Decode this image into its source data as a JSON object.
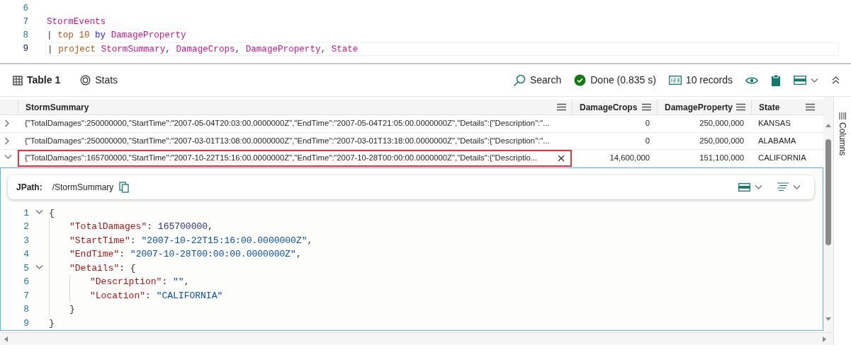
{
  "editor": {
    "lines": [
      {
        "number": "6",
        "current": false
      },
      {
        "number": "7",
        "current": false,
        "tokens": [
          {
            "text": "StormEvents",
            "kind": "identifier"
          }
        ]
      },
      {
        "number": "8",
        "current": false,
        "tokens": [
          {
            "text": "|",
            "kind": "pipe"
          },
          {
            "text": "top",
            "kind": "command"
          },
          {
            "text": "10",
            "kind": "literal"
          },
          {
            "text": "by",
            "kind": "operator"
          },
          {
            "text": "DamageProperty",
            "kind": "identifier"
          }
        ]
      },
      {
        "number": "9",
        "current": true,
        "tokens": [
          {
            "text": "|",
            "kind": "pipe"
          },
          {
            "text": "project",
            "kind": "command"
          },
          {
            "text": "StormSummary",
            "kind": "identifier"
          },
          {
            "text": ",",
            "kind": "punct"
          },
          {
            "text": "DamageCrops",
            "kind": "identifier"
          },
          {
            "text": ",",
            "kind": "punct"
          },
          {
            "text": "DamageProperty",
            "kind": "identifier"
          },
          {
            "text": ",",
            "kind": "punct"
          },
          {
            "text": "State",
            "kind": "identifier"
          }
        ]
      }
    ]
  },
  "results": {
    "tabs": [
      {
        "label": "Table 1",
        "selected": true,
        "kind": "table"
      },
      {
        "label": "Stats",
        "selected": false,
        "kind": "stats"
      }
    ],
    "search": "Search",
    "status": "Done (0.835 s)",
    "records": "10 records"
  },
  "table": {
    "columns": [
      "StormSummary",
      "DamageCrops",
      "DamageProperty",
      "State"
    ],
    "rows": [
      {
        "expanded": false,
        "selected": false,
        "cells": [
          "{\"TotalDamages\":250000000,\"StartTime\":\"2007-05-04T20:03:00.0000000Z\",\"EndTime\":\"2007-05-04T21:05:00.0000000Z\",\"Details\":{\"Description\":\"...",
          "0",
          "250,000,000",
          "KANSAS"
        ]
      },
      {
        "expanded": false,
        "selected": false,
        "cells": [
          "{\"TotalDamages\":250000000,\"StartTime\":\"2007-03-01T13:08:00.0000000Z\",\"EndTime\":\"2007-03-01T13:18:00.0000000Z\",\"Details\":{\"Description\":\"...",
          "0",
          "250,000,000",
          "ALABAMA"
        ]
      },
      {
        "expanded": true,
        "selected": true,
        "cells": [
          "{\"TotalDamages\":165700000,\"StartTime\":\"2007-10-22T15:16:00.0000000Z\",\"EndTime\":\"2007-10-28T00:00:00.0000000Z\",\"Details\":{\"Descriptio...",
          "14,600,000",
          "151,100,000",
          "CALIFORNIA"
        ]
      }
    ]
  },
  "detail": {
    "jpath_label": "JPath:",
    "jpath": "/StormSummary",
    "lines": [
      {
        "number": "1",
        "expanded": true,
        "tokens": [
          {
            "text": "{",
            "kind": "punct"
          }
        ],
        "children": [
          {
            "number": "2",
            "tokens": [
              {
                "text": "\"TotalDamages\"",
                "kind": "key"
              },
              {
                "text": ":",
                "kind": "punct"
              },
              {
                "text": "165700000",
                "kind": "number"
              },
              {
                "text": ",",
                "kind": "punct"
              }
            ]
          },
          {
            "number": "3",
            "tokens": [
              {
                "text": "\"StartTime\"",
                "kind": "key"
              },
              {
                "text": ":",
                "kind": "punct"
              },
              {
                "text": "\"2007-10-22T15:16:00.0000000Z\"",
                "kind": "string"
              },
              {
                "text": ",",
                "kind": "punct"
              }
            ]
          },
          {
            "number": "4",
            "tokens": [
              {
                "text": "\"EndTime\"",
                "kind": "key"
              },
              {
                "text": ":",
                "kind": "punct"
              },
              {
                "text": "\"2007-10-28T00:00:00.0000000Z\"",
                "kind": "string"
              },
              {
                "text": ",",
                "kind": "punct"
              }
            ]
          },
          {
            "number": "5",
            "expanded": true,
            "tokens": [
              {
                "text": "\"Details\"",
                "kind": "key"
              },
              {
                "text": ":",
                "kind": "punct"
              },
              {
                "text": "{",
                "kind": "brace"
              }
            ],
            "children": [
              {
                "number": "6",
                "tokens": [
                  {
                    "text": "\"Description\"",
                    "kind": "key"
                  },
                  {
                    "text": ":",
                    "kind": "punct"
                  },
                  {
                    "text": "\"\"",
                    "kind": "string"
                  },
                  {
                    "text": ",",
                    "kind": "punct"
                  }
                ]
              },
              {
                "number": "7",
                "tokens": [
                  {
                    "text": "\"Location\"",
                    "kind": "key"
                  },
                  {
                    "text": ":",
                    "kind": "punct"
                  },
                  {
                    "text": "\"CALIFORNIA\"",
                    "kind": "string"
                  }
                ]
              }
            ]
          },
          {
            "number": "8",
            "tokens": [
              {
                "text": "}",
                "kind": "punct"
              }
            ]
          }
        ]
      },
      {
        "number": "9",
        "tokens": [
          {
            "text": "}",
            "kind": "punct"
          }
        ]
      }
    ]
  },
  "side_panel": {
    "label": "Columns"
  }
}
